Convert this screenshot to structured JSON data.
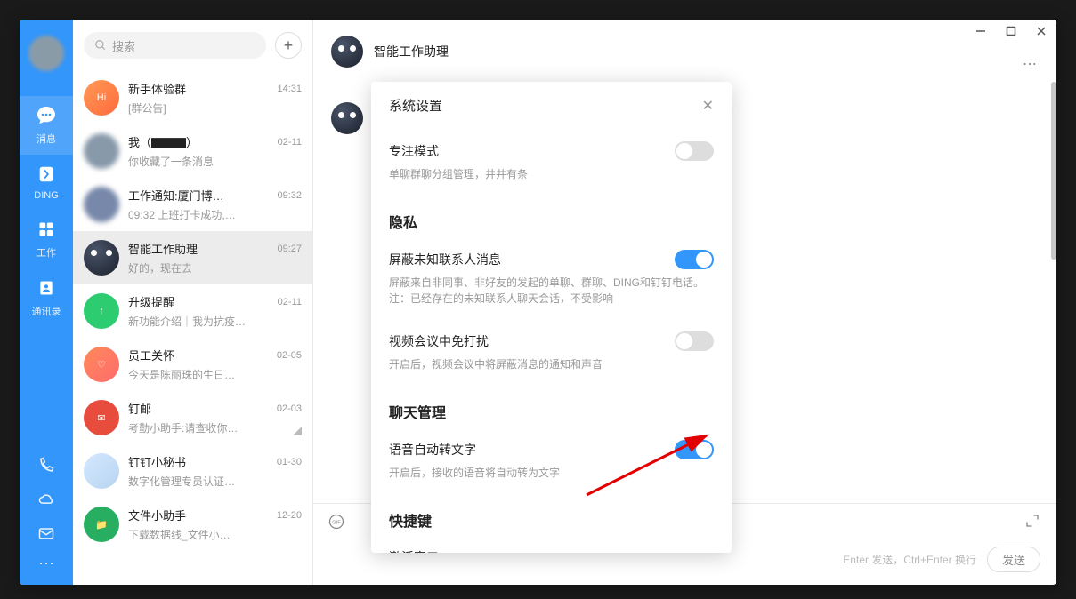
{
  "sidebar": {
    "items": [
      {
        "label": "消息",
        "icon": "chat"
      },
      {
        "label": "DING",
        "icon": "ding"
      },
      {
        "label": "工作",
        "icon": "apps"
      },
      {
        "label": "通讯录",
        "icon": "contacts"
      }
    ]
  },
  "search": {
    "placeholder": "搜索"
  },
  "conversations": [
    {
      "title": "新手体验群",
      "preview": "[群公告]",
      "time": "14:31",
      "avatar": "av-orange",
      "badge": "Hi"
    },
    {
      "title": "我（▇▇▇）",
      "preview": "你收藏了一条消息",
      "time": "02-11",
      "avatar": "av-blur"
    },
    {
      "title": "工作通知:厦门博…",
      "preview": "09:32 上班打卡成功,…",
      "time": "09:32",
      "avatar": "av-blur2"
    },
    {
      "title": "智能工作助理",
      "preview": "好的，现在去",
      "time": "09:27",
      "avatar": "cookie",
      "selected": true
    },
    {
      "title": "升级提醒",
      "preview": "新功能介绍｜我为抗疫…",
      "time": "02-11",
      "avatar": "av-green",
      "badge": "↑"
    },
    {
      "title": "员工关怀",
      "preview": "今天是陈丽珠的生日…",
      "time": "02-05",
      "avatar": "av-heart",
      "badge": "♡"
    },
    {
      "title": "钉邮",
      "preview": "考勤小助手:请查收你…",
      "time": "02-03",
      "avatar": "av-red",
      "badge": "✉",
      "pinned": true
    },
    {
      "title": "钉钉小秘书",
      "preview": "数字化管理专员认证…",
      "time": "01-30",
      "avatar": "av-photo"
    },
    {
      "title": "文件小助手",
      "preview": "下载数据线_文件小…",
      "time": "12-20",
      "avatar": "av-green2",
      "badge": "📁"
    }
  ],
  "chat": {
    "title": "智能工作助理"
  },
  "footer": {
    "hint": "Enter 发送，Ctrl+Enter 换行",
    "send": "发送"
  },
  "modal": {
    "title": "系统设置",
    "sections": [
      {
        "items": [
          {
            "label": "专注模式",
            "desc": "单聊群聊分组管理，井井有条",
            "on": false
          }
        ]
      },
      {
        "title": "隐私",
        "items": [
          {
            "label": "屏蔽未知联系人消息",
            "desc": "屏蔽来自非同事、非好友的发起的单聊、群聊、DING和钉钉电话。注：已经存在的未知联系人聊天会话，不受影响",
            "on": true
          },
          {
            "label": "视频会议中免打扰",
            "desc": "开启后，视频会议中将屏蔽消息的通知和声音",
            "on": false
          }
        ]
      },
      {
        "title": "聊天管理",
        "items": [
          {
            "label": "语音自动转文字",
            "desc": "开启后，接收的语音将自动转为文字",
            "on": true
          }
        ]
      },
      {
        "title": "快捷键",
        "items": [
          {
            "label": "激活窗口"
          }
        ]
      }
    ]
  }
}
